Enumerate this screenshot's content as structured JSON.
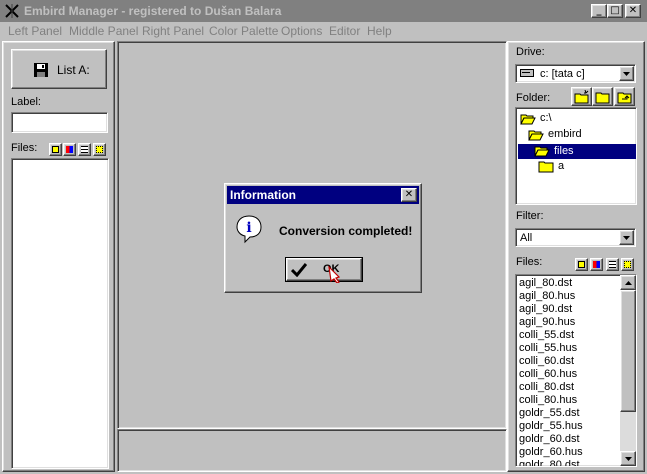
{
  "window": {
    "title": "Embird Manager - registered to Dušan Balara",
    "minimize_glyph": "_",
    "maximize_glyph": "□",
    "close_glyph": "✕"
  },
  "menu": [
    "Left Panel",
    "Middle Panel",
    "Right Panel",
    "Color Palette",
    "Options",
    "Editor",
    "Help"
  ],
  "left_panel": {
    "list_button_label": "List A:",
    "label_caption": "Label:",
    "label_value": "",
    "files_caption": "Files:"
  },
  "right_panel": {
    "drive_caption": "Drive:",
    "drive_value": "c: [tata c]",
    "folder_caption": "Folder:",
    "folders": [
      "c:\\",
      "embird",
      "files",
      "a"
    ],
    "selected_folder": "files",
    "filter_caption": "Filter:",
    "filter_value": "All",
    "files_caption": "Files:",
    "files": [
      "agil_80.dst",
      "agil_80.hus",
      "agil_90.dst",
      "agil_90.hus",
      "colli_55.dst",
      "colli_55.hus",
      "colli_60.dst",
      "colli_60.hus",
      "colli_80.dst",
      "colli_80.hus",
      "goldr_55.dst",
      "goldr_55.hus",
      "goldr_60.dst",
      "goldr_60.hus",
      "goldr_80.dst"
    ]
  },
  "dialog": {
    "title": "Information",
    "close_glyph": "✕",
    "message": "Conversion completed!",
    "ok_label": "OK",
    "info_glyph": "i"
  },
  "colors": {
    "title_inactive": "#808080",
    "dialog_title": "#000080",
    "selection": "#000080",
    "face": "#c0c0c0"
  }
}
